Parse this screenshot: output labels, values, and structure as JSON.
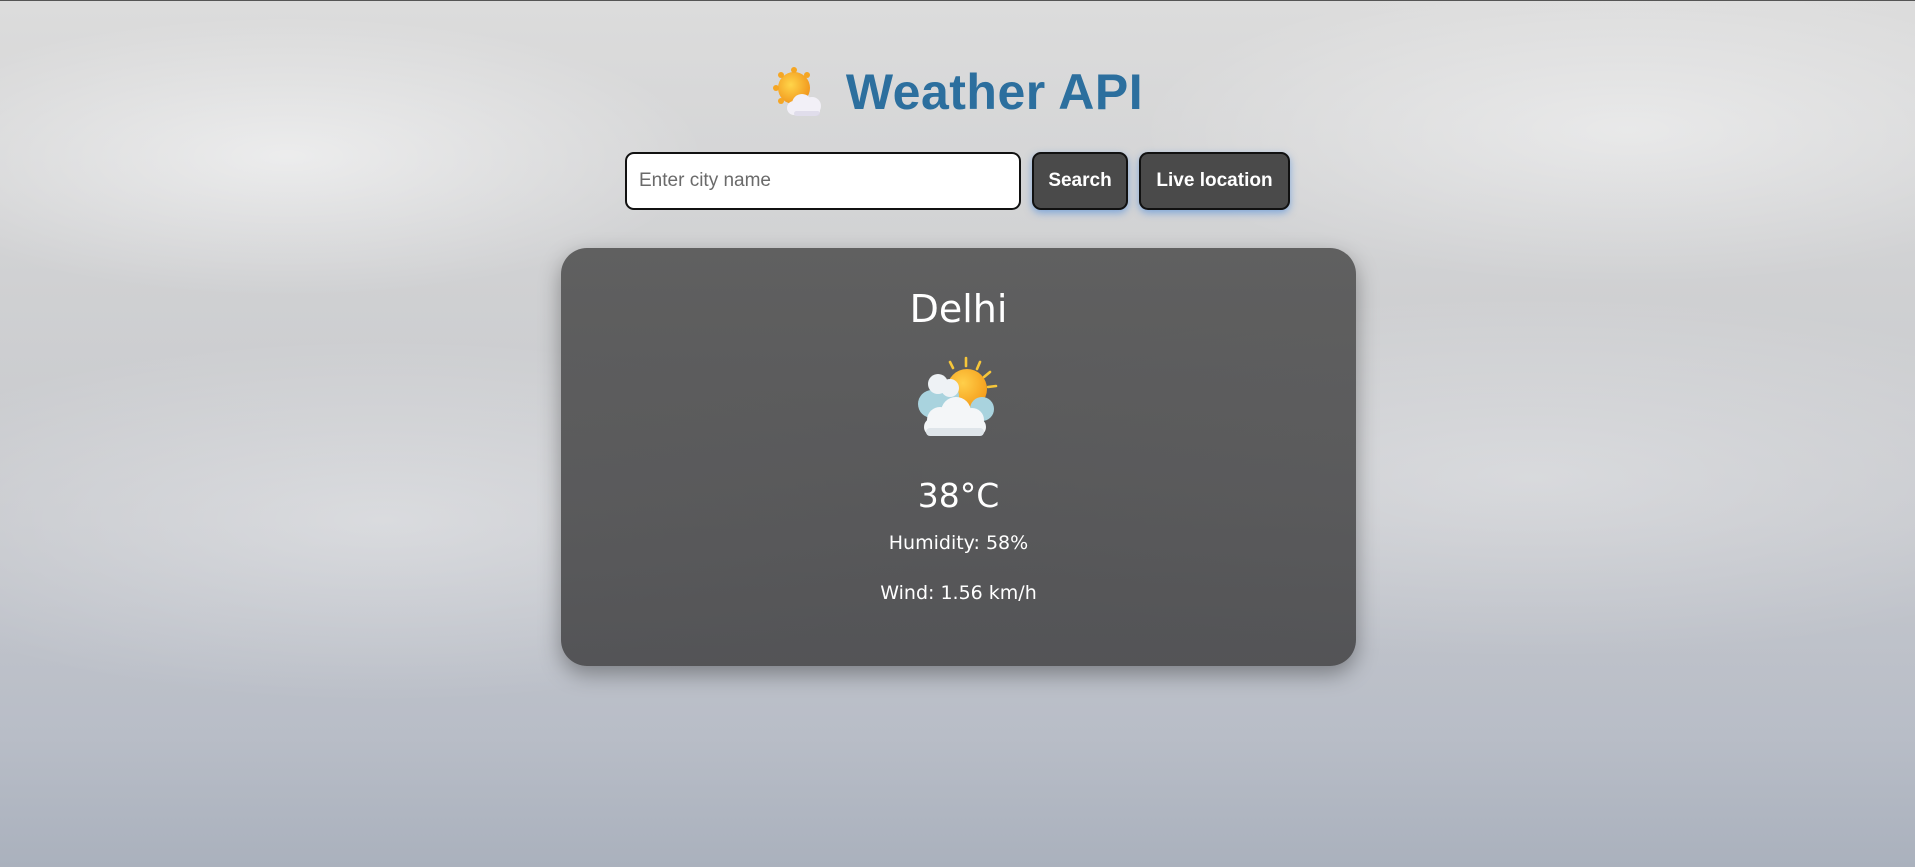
{
  "header": {
    "title": "Weather API",
    "icon": "sun-behind-cloud-icon"
  },
  "search": {
    "placeholder": "Enter city name",
    "value": "",
    "search_label": "Search",
    "live_location_label": "Live location"
  },
  "weather": {
    "city": "Delhi",
    "icon": "sun-behind-clouds-icon",
    "temperature": "38°C",
    "humidity": "Humidity: 58%",
    "wind": "Wind: 1.56 km/h"
  },
  "colors": {
    "title": "#2c6f9e",
    "button_bg": "#4a4a4a",
    "card_bg": "#505050"
  }
}
